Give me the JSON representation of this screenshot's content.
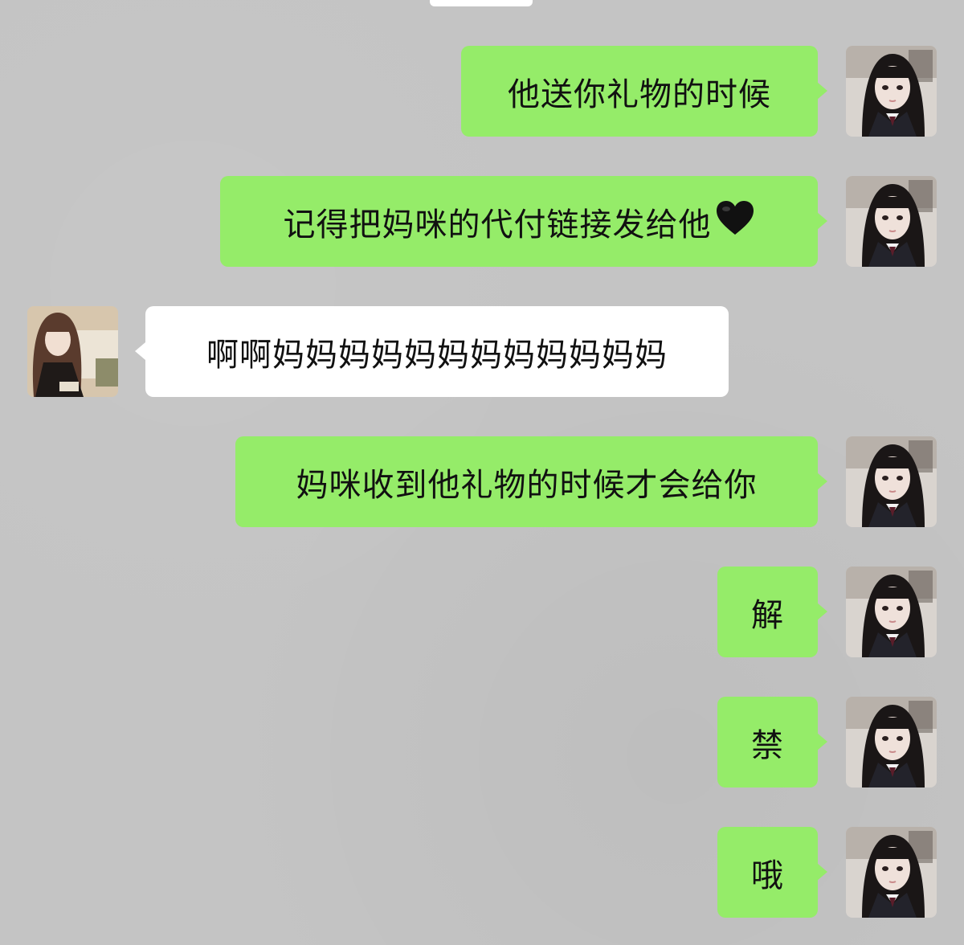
{
  "messages": [
    {
      "side": "out",
      "text": "他送你礼物的时候"
    },
    {
      "side": "out",
      "text": "记得把妈咪的代付链接发给他",
      "emoji": "black-heart"
    },
    {
      "side": "in",
      "text": "啊啊妈妈妈妈妈妈妈妈妈妈妈妈"
    },
    {
      "side": "out",
      "text": "妈咪收到他礼物的时候才会给你"
    },
    {
      "side": "out",
      "text": "解"
    },
    {
      "side": "out",
      "text": "禁"
    },
    {
      "side": "out",
      "text": "哦"
    }
  ],
  "colors": {
    "background": "#c4c4c4",
    "outgoing_bubble": "#95ec69",
    "incoming_bubble": "#ffffff"
  },
  "avatars": {
    "self": "photo-avatar-dark-hair-uniform",
    "other": "photo-avatar-long-brown-hair"
  }
}
